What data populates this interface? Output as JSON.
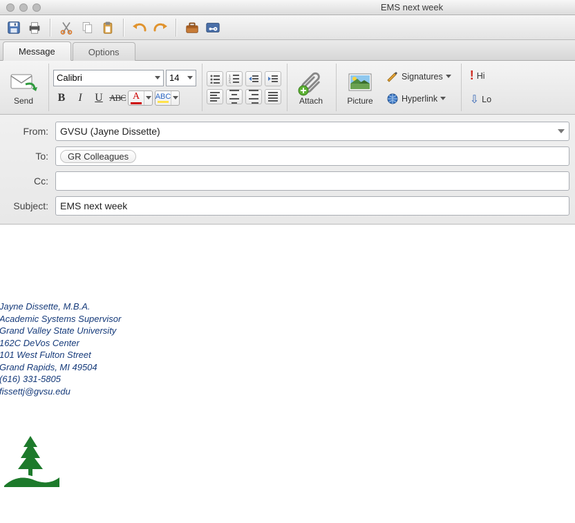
{
  "window": {
    "title": "EMS next week"
  },
  "tabs": {
    "message": "Message",
    "options": "Options"
  },
  "ribbon": {
    "send": "Send",
    "font_name": "Calibri",
    "font_size": "14",
    "attach": "Attach",
    "picture": "Picture",
    "signatures": "Signatures",
    "hyperlink": "Hyperlink",
    "hi": "Hi",
    "lo": "Lo"
  },
  "headers": {
    "from_label": "From:",
    "from_value": "GVSU (Jayne Dissette)",
    "to_label": "To:",
    "to_token": "GR Colleagues",
    "cc_label": "Cc:",
    "cc_value": "",
    "subject_label": "Subject:",
    "subject_value": "EMS next week"
  },
  "signature": {
    "name": "Jayne Dissette, M.B.A.",
    "title": "Academic Systems Supervisor",
    "org": "Grand Valley State University",
    "addr1": "162C DeVos Center",
    "addr2": "101 West Fulton Street",
    "citystate": "Grand Rapids, MI  49504",
    "phone": "(616) 331-5805",
    "email": "fissettj@gvsu.edu"
  }
}
